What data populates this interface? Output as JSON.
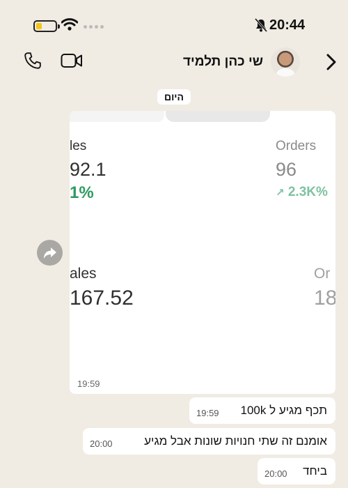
{
  "status_bar": {
    "time": "20:44"
  },
  "header": {
    "contact_name": "שי כהן תלמיד"
  },
  "date_chip": "היום",
  "image_message": {
    "time": "19:59",
    "stats": [
      {
        "label": "les",
        "value": "92.1",
        "change": "1%"
      },
      {
        "label": "Orders",
        "value": "96",
        "change": "2.3K%",
        "arrow": "↗"
      },
      {
        "label": "ales",
        "value": "167.52"
      },
      {
        "label": "Or",
        "value": "18"
      }
    ]
  },
  "messages": [
    {
      "text": "תכף מגיע ל 100k",
      "time": "19:59"
    },
    {
      "text": "אומנם זה שתי חנויות שונות אבל מגיע",
      "time": "20:00"
    },
    {
      "text": "ביחד",
      "time": "20:00"
    }
  ],
  "colors": {
    "background": "#f0ece3",
    "bubble": "#ffffff",
    "positive_change": "#2e9b62",
    "battery": "#f5c518"
  },
  "icons": [
    "battery-icon",
    "wifi-icon",
    "cellular-icon",
    "bell-muted-icon",
    "phone-icon",
    "video-icon",
    "avatar",
    "chevron-right-icon",
    "forward-icon"
  ]
}
